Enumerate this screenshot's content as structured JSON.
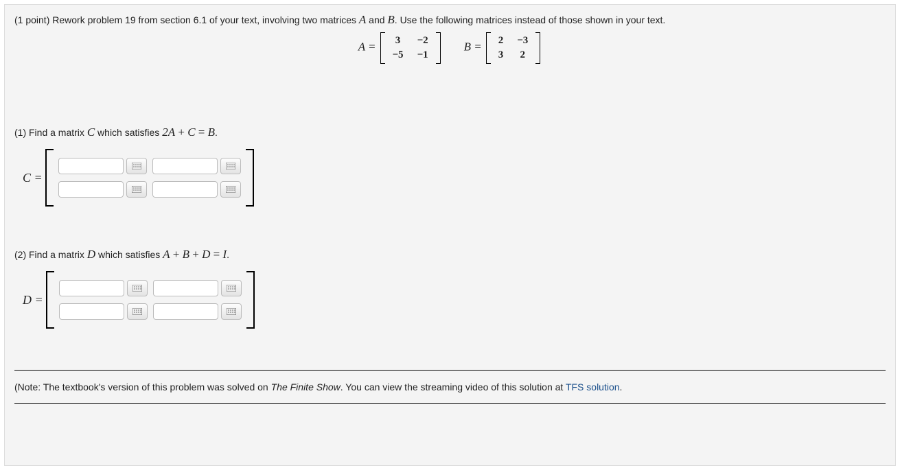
{
  "intro": {
    "prefix": "(1 point) Rework problem 19 from section 6.1 of your text, involving two matrices ",
    "varA": "A",
    "mid": " and ",
    "varB": "B",
    "suffix": ". Use the following matrices instead of those shown in your text."
  },
  "matrices": {
    "A_label": "A =",
    "A": [
      [
        "3",
        "−2"
      ],
      [
        "−5",
        "−1"
      ]
    ],
    "B_label": "B =",
    "B": [
      [
        "2",
        "−3"
      ],
      [
        "3",
        "2"
      ]
    ]
  },
  "part1": {
    "prefix": "(1) Find a matrix ",
    "varC": "C",
    "mid": " which satisfies ",
    "equation": "2A + C = B",
    "suffix": "."
  },
  "C_label": "C =",
  "part2": {
    "prefix": "(2) Find a matrix ",
    "varD": "D",
    "mid": " which satisfies ",
    "equation": "A + B + D = I",
    "suffix": "."
  },
  "D_label": "D =",
  "note": {
    "prefix": "(Note: The textbook's version of this problem was solved on ",
    "show": "The Finite Show",
    "mid": ". You can view the streaming video of this solution at ",
    "link": "TFS solution",
    "suffix": "."
  }
}
